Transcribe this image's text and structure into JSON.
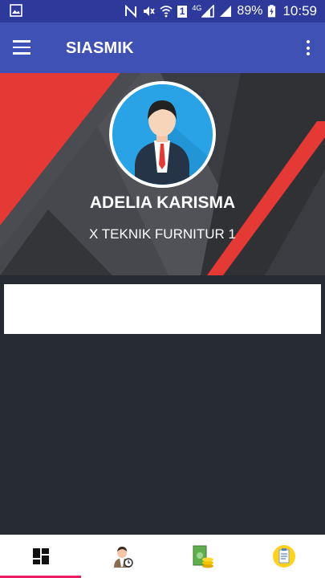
{
  "status_bar": {
    "battery_percent": "89%",
    "time": "10:59",
    "network": "4G",
    "sim_indicator": "1"
  },
  "app_bar": {
    "title": "SIASMIK"
  },
  "profile": {
    "name": "ADELIA KARISMA",
    "class_name": "X TEKNIK FURNITUR 1"
  },
  "bottom_nav": {
    "items": [
      {
        "icon": "dashboard-icon",
        "active": true
      },
      {
        "icon": "student-icon",
        "active": false
      },
      {
        "icon": "money-icon",
        "active": false
      },
      {
        "icon": "document-icon",
        "active": false
      }
    ]
  },
  "colors": {
    "status_bar": "#2d3a9c",
    "app_bar": "#3f51b5",
    "accent": "#e91e63",
    "banner_red": "#e53935",
    "background": "#262a33"
  }
}
